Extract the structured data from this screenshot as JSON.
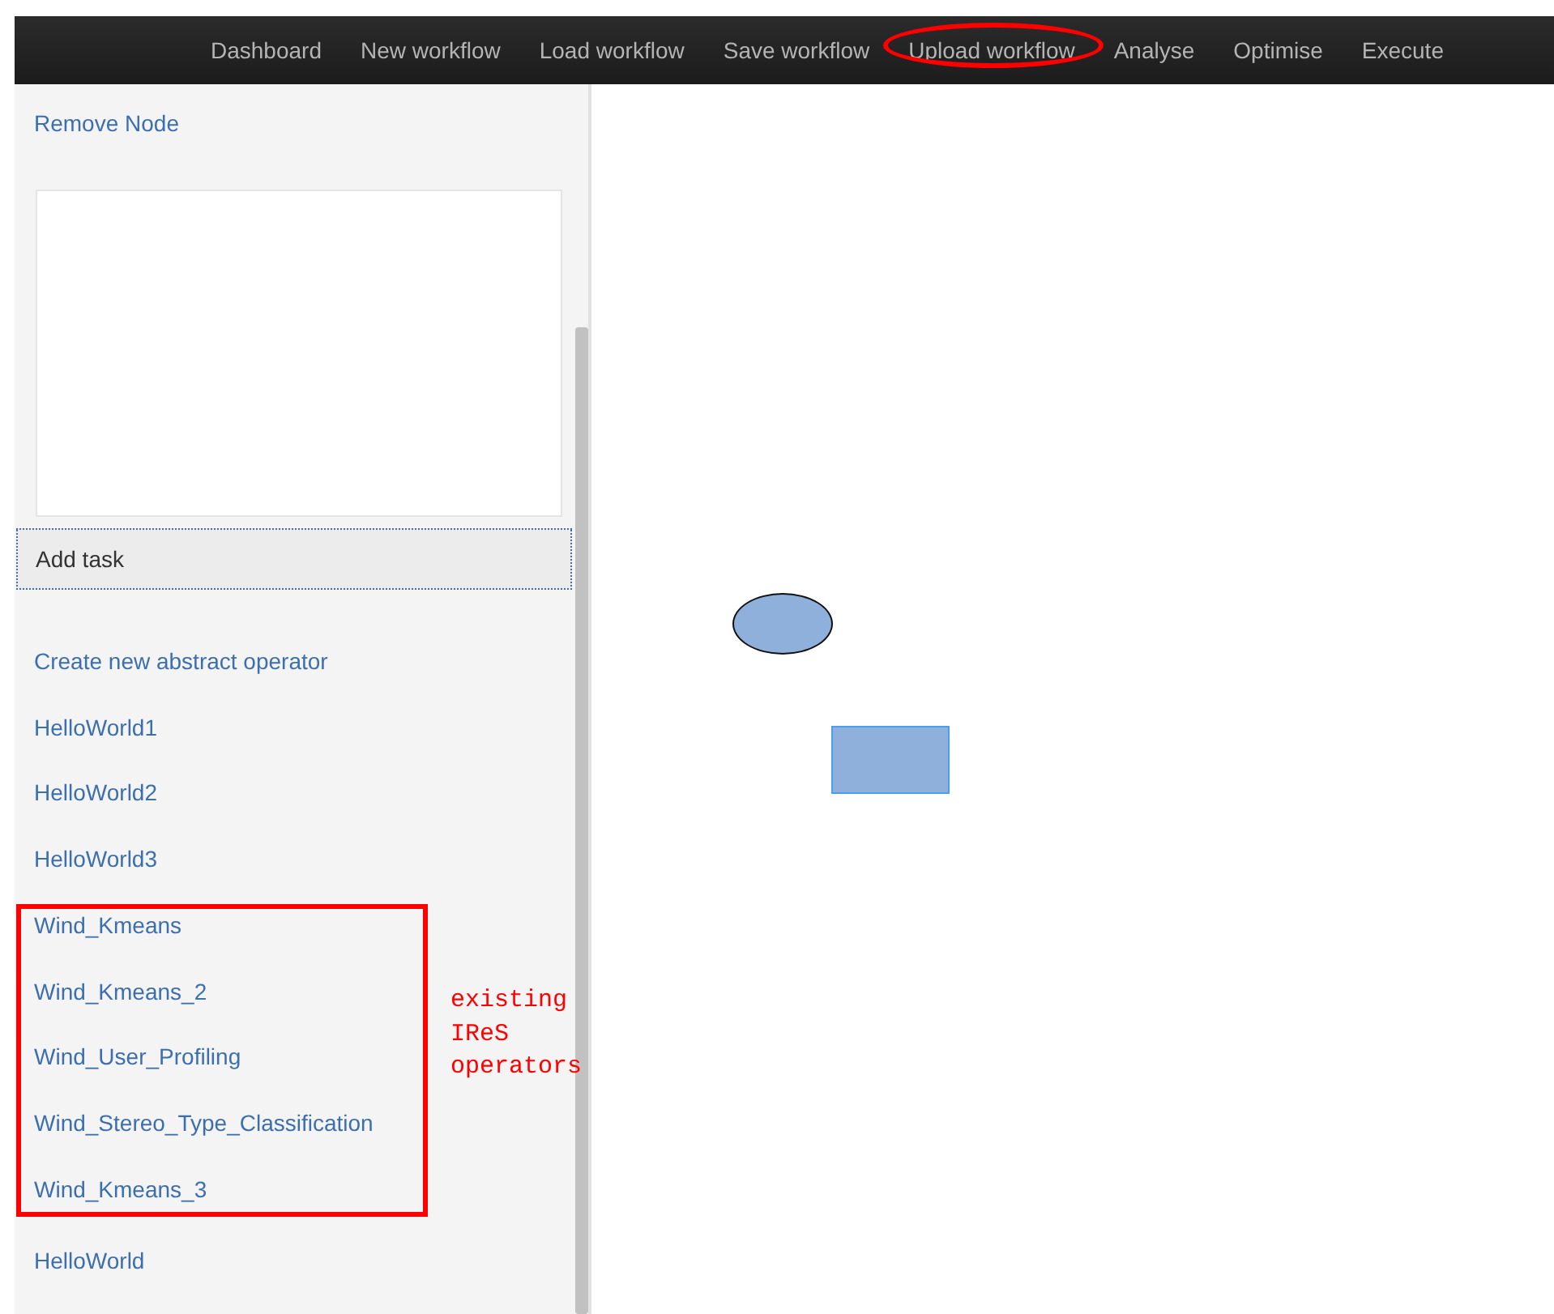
{
  "nav": [
    {
      "label": "Dashboard",
      "annotated": false
    },
    {
      "label": "New workflow",
      "annotated": false
    },
    {
      "label": "Load workflow",
      "annotated": false
    },
    {
      "label": "Save workflow",
      "annotated": false
    },
    {
      "label": "Upload workflow",
      "annotated": true
    },
    {
      "label": "Analyse",
      "annotated": false
    },
    {
      "label": "Optimise",
      "annotated": false
    },
    {
      "label": "Execute",
      "annotated": false
    }
  ],
  "sidebar": {
    "remove_link": "Remove Node",
    "add_task": "Add task",
    "operators": [
      {
        "label": "Create new abstract operator",
        "annotated": false
      },
      {
        "label": "HelloWorld1",
        "annotated": false
      },
      {
        "label": "HelloWorld2",
        "annotated": false
      },
      {
        "label": "HelloWorld3",
        "annotated": false
      },
      {
        "label": "Wind_Kmeans",
        "annotated": true
      },
      {
        "label": "Wind_Kmeans_2",
        "annotated": true
      },
      {
        "label": "Wind_User_Profiling",
        "annotated": true
      },
      {
        "label": "Wind_Stereo_Type_Classification",
        "annotated": true
      },
      {
        "label": "Wind_Kmeans_3",
        "annotated": true
      },
      {
        "label": "HelloWorld",
        "annotated": false
      }
    ],
    "annotation_note": "existing IReS operators"
  },
  "canvas": {
    "nodes": [
      {
        "kind": "ellipse"
      },
      {
        "kind": "rect"
      }
    ]
  }
}
